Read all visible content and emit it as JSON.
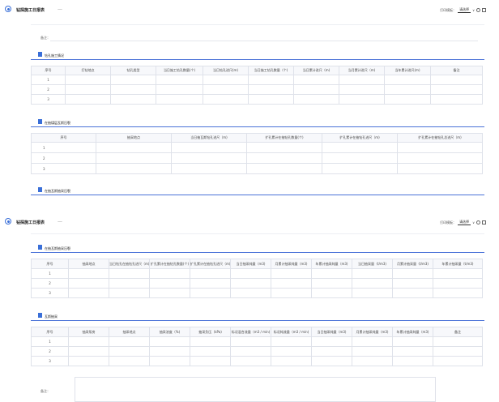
{
  "app": {
    "title": "钻探施工日报表",
    "tab_close": "—",
    "printer_label": "打印模板：",
    "printer_select": "请选择",
    "printer_select_arrow": "∨"
  },
  "panel1": {
    "remark_label": "备注：",
    "section1": {
      "title": "钻孔施工情况",
      "columns": [
        "序号",
        "打钻地点",
        "钻孔类型",
        "当日施工钻孔数量(个)",
        "当日钻孔进尺(m)",
        "当日施工钻孔数量（个)",
        "当日累计进尺（m)",
        "当月累计进尺（m)",
        "当年累计进尺(m)",
        "备注"
      ],
      "rows": [
        "1",
        "2",
        "3"
      ]
    },
    "section2": {
      "title": "在抽煤层瓦斯压裂",
      "columns": [
        "序号",
        "抽采地点",
        "当日抽瓦斯钻孔进尺（m)",
        "扩孔累计在抽钻孔数量(个)",
        "扩孔累计在抽钻孔进尺（m)",
        "扩孔累计在抽钻孔总进尺（m)"
      ],
      "rows": [
        "1",
        "2",
        "3"
      ]
    },
    "section3_title": "在抽瓦斯抽采压裂"
  },
  "panel2": {
    "section1": {
      "title": "在抽瓦斯抽采压裂",
      "columns": [
        "序号",
        "抽采地点",
        "当日钻孔在抽钻孔进尺（m)",
        "扩孔累计在抽钻孔数量(个)",
        "扩孔累计在抽钻孔进尺（m)",
        "当日抽采纯量（m3)",
        "月累计抽采纯量（m3)",
        "年累计抽采纯量（m3)",
        "当日抽采量（t/m3)",
        "月累计抽采量（t/m3)",
        "年累计抽采量（t/m3)"
      ],
      "rows": [
        "1",
        "2",
        "3"
      ]
    },
    "section2": {
      "title": "瓦斯抽采",
      "columns": [
        "序号",
        "抽采泵房",
        "抽采地点",
        "抽采浓度（%)",
        "抽采负压（kPa)",
        "标况混合流量（m3 / min)",
        "标况纯流量（m3 / min)",
        "当日抽采纯量（m3)",
        "月累计抽采纯量（m3)",
        "年累计抽采纯量（m3)",
        "备注"
      ],
      "rows": [
        "1",
        "2",
        "3"
      ]
    },
    "remark_label": "备注："
  }
}
